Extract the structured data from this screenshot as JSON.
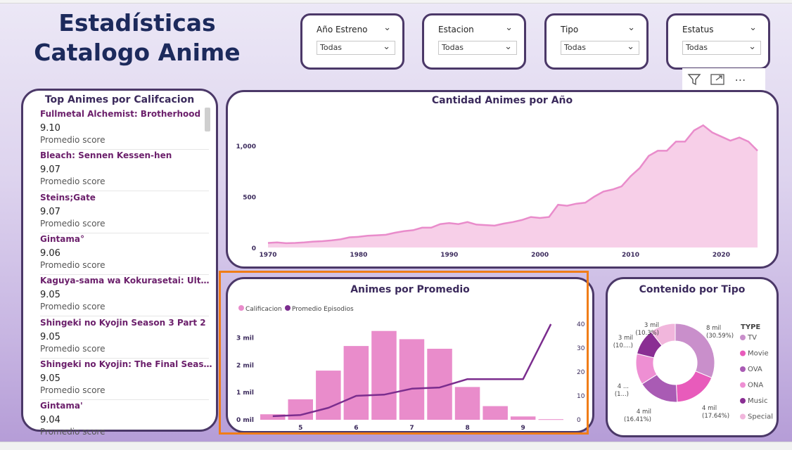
{
  "header": {
    "line1": "Estadísticas",
    "line2": "Catalogo Anime"
  },
  "slicers": [
    {
      "label": "Año Estreno",
      "value": "Todas"
    },
    {
      "label": "Estacion",
      "value": "Todas"
    },
    {
      "label": "Tipo",
      "value": "Todas"
    },
    {
      "label": "Estatus",
      "value": "Todas"
    }
  ],
  "toolbar": {
    "filter_icon": "filter-icon",
    "focus_icon": "focus-mode-icon",
    "more_icon": "more-options-icon",
    "more_glyph": "⋯"
  },
  "top_list": {
    "title": "Top Animes por Califcacion",
    "caption": "Promedio score",
    "items": [
      {
        "name": "Fullmetal Alchemist: Brotherhood",
        "score": "9.10"
      },
      {
        "name": "Bleach: Sennen Kessen-hen",
        "score": "9.07"
      },
      {
        "name": "Steins;Gate",
        "score": "9.07"
      },
      {
        "name": "Gintama°",
        "score": "9.06"
      },
      {
        "name": "Kaguya-sama wa Kokurasetai: Ultra Rom...",
        "score": "9.05"
      },
      {
        "name": "Shingeki no Kyojin Season 3 Part 2",
        "score": "9.05"
      },
      {
        "name": "Shingeki no Kyojin: The Final Season - Ka...",
        "score": "9.05"
      },
      {
        "name": "Gintama'",
        "score": "9.04"
      }
    ]
  },
  "colors": {
    "accent": "#e98ccb",
    "line": "#7b2d8e",
    "border": "#4b3868",
    "highlight": "#f07d18"
  },
  "chart_data": [
    {
      "type": "area",
      "title": "Cantidad Animes por Año",
      "x": [
        1970,
        1971,
        1972,
        1973,
        1974,
        1975,
        1976,
        1977,
        1978,
        1979,
        1980,
        1981,
        1982,
        1983,
        1984,
        1985,
        1986,
        1987,
        1988,
        1989,
        1990,
        1991,
        1992,
        1993,
        1994,
        1995,
        1996,
        1997,
        1998,
        1999,
        2000,
        2001,
        2002,
        2003,
        2004,
        2005,
        2006,
        2007,
        2008,
        2009,
        2010,
        2011,
        2012,
        2013,
        2014,
        2015,
        2016,
        2017,
        2018,
        2019,
        2020,
        2021,
        2022,
        2023,
        2024
      ],
      "values": [
        45,
        50,
        42,
        45,
        50,
        58,
        62,
        70,
        80,
        100,
        105,
        115,
        120,
        125,
        145,
        160,
        170,
        195,
        195,
        230,
        240,
        230,
        250,
        225,
        220,
        215,
        235,
        250,
        270,
        300,
        290,
        300,
        420,
        410,
        430,
        440,
        500,
        550,
        570,
        600,
        700,
        780,
        900,
        950,
        950,
        1040,
        1040,
        1150,
        1200,
        1130,
        1090,
        1050,
        1080,
        1040,
        950
      ],
      "x_ticks": [
        "1970",
        "1980",
        "1990",
        "2000",
        "2010",
        "2020"
      ],
      "y_ticks": [
        "0",
        "500",
        "1,000"
      ],
      "ylim": [
        0,
        1250
      ],
      "grid": false
    },
    {
      "type": "bar",
      "title": "Animes por Promedio",
      "legend": [
        "Calificacion",
        "Promedio Episodios"
      ],
      "legend_position": "top-left",
      "categories": [
        "4",
        "5",
        "5.5",
        "6",
        "6.5",
        "7",
        "7.5",
        "8",
        "8.5",
        "9",
        "9.5"
      ],
      "x_ticks": [
        "5",
        "6",
        "7",
        "8",
        "9"
      ],
      "series": [
        {
          "name": "Calificacion",
          "axis": "left",
          "values": [
            200,
            750,
            1800,
            2700,
            3250,
            2950,
            2600,
            1200,
            500,
            120,
            20
          ]
        },
        {
          "name": "Promedio Episodios",
          "axis": "right",
          "type": "line",
          "values": [
            1.5,
            2,
            5,
            10,
            10.5,
            13,
            13.5,
            17,
            17,
            17,
            40
          ]
        }
      ],
      "y_ticks_left": [
        "0 mil",
        "1 mil",
        "2 mil",
        "3 mil"
      ],
      "y_ticks_right": [
        "0",
        "10",
        "20",
        "30",
        "40"
      ],
      "ylim_left": [
        0,
        3500
      ],
      "ylim_right": [
        0,
        40
      ]
    },
    {
      "type": "pie",
      "title": "Contenido por Tipo",
      "legend_title": "TYPE",
      "labels": [
        "TV",
        "Movie",
        "OVA",
        "ONA",
        "Music",
        "Special"
      ],
      "values": [
        30.59,
        17.64,
        16.41,
        12.5,
        10.56,
        10.3
      ],
      "slice_labels": [
        {
          "line1": "8 mil",
          "line2": "(30.59%)"
        },
        {
          "line1": "4 mil",
          "line2": "(17.64%)"
        },
        {
          "line1": "4 mil",
          "line2": "(16.41%)"
        },
        {
          "line1": "4 ...",
          "line2": "(1...)"
        },
        {
          "line1": "3 mil",
          "line2": "(10....)"
        },
        {
          "line1": "3 mil",
          "line2": "(10.3%)"
        }
      ],
      "colors": [
        "#c98fcb",
        "#e85bbb",
        "#a95bb4",
        "#ee8fd3",
        "#8a2e93",
        "#f1b6dc"
      ]
    }
  ]
}
